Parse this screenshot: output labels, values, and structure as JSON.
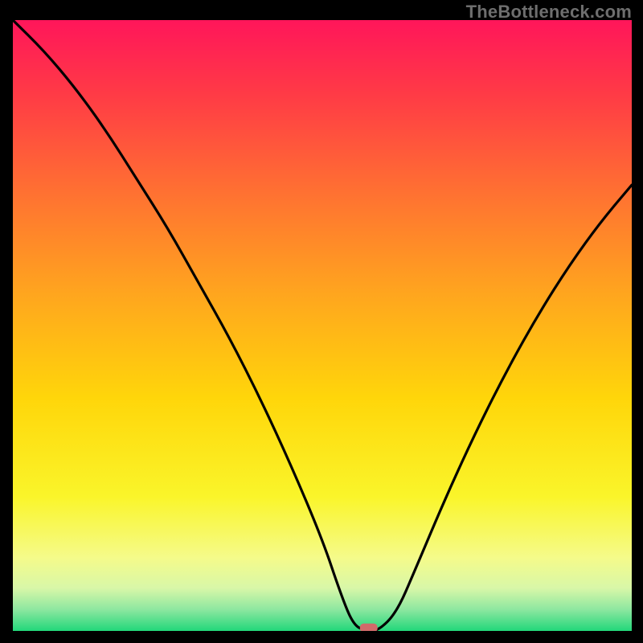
{
  "watermark": "TheBottleneck.com",
  "chart_data": {
    "type": "line",
    "title": "",
    "xlabel": "",
    "ylabel": "",
    "xlim": [
      0,
      100
    ],
    "ylim": [
      0,
      100
    ],
    "grid": false,
    "legend": false,
    "background_gradient": {
      "stops": [
        {
          "offset": 0.0,
          "color": "#ff165a"
        },
        {
          "offset": 0.12,
          "color": "#ff3a46"
        },
        {
          "offset": 0.28,
          "color": "#ff7032"
        },
        {
          "offset": 0.45,
          "color": "#ffa61e"
        },
        {
          "offset": 0.62,
          "color": "#ffd60a"
        },
        {
          "offset": 0.78,
          "color": "#faf52a"
        },
        {
          "offset": 0.88,
          "color": "#f5fb8a"
        },
        {
          "offset": 0.93,
          "color": "#d8f7a8"
        },
        {
          "offset": 0.965,
          "color": "#8de7a0"
        },
        {
          "offset": 1.0,
          "color": "#22d77a"
        }
      ]
    },
    "series": [
      {
        "name": "bottleneck-curve",
        "x": [
          0,
          5,
          10,
          15,
          20,
          25,
          30,
          35,
          40,
          45,
          50,
          53,
          55,
          57,
          59,
          62,
          65,
          70,
          75,
          80,
          85,
          90,
          95,
          100
        ],
        "y": [
          100,
          95,
          89,
          82,
          74,
          66,
          57,
          48,
          38,
          27,
          15,
          6,
          1,
          0,
          0,
          3,
          10,
          22,
          33,
          43,
          52,
          60,
          67,
          73
        ]
      }
    ],
    "marker": {
      "x": 57.5,
      "y": 0.5,
      "color": "#d26a6a",
      "shape": "capsule"
    }
  }
}
